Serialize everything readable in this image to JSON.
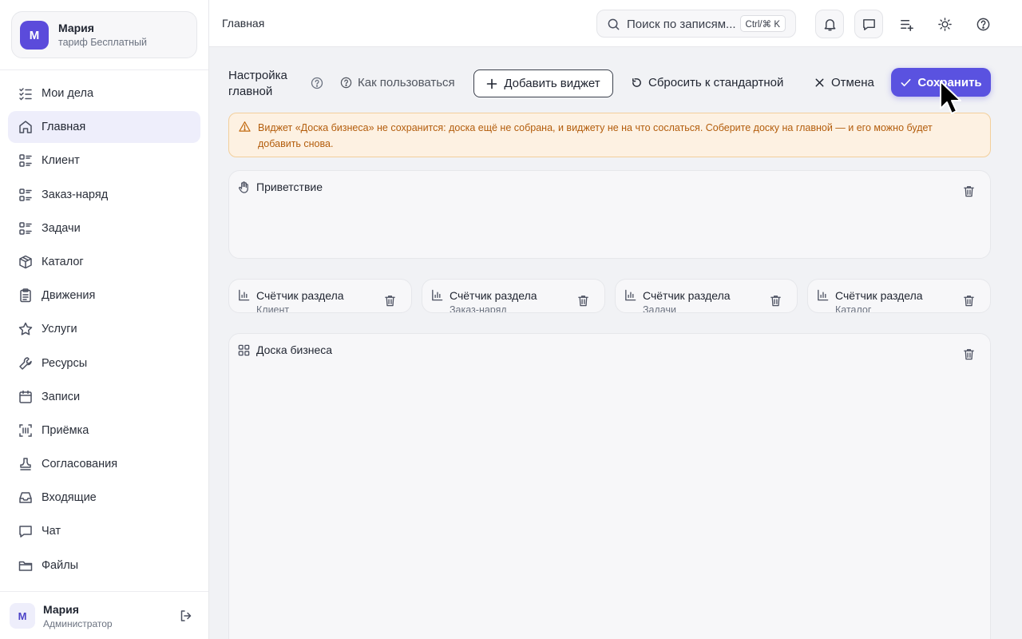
{
  "account": {
    "avatar": "М",
    "name": "Мария",
    "plan": "тариф Бесплатный"
  },
  "sidebar": {
    "items": [
      {
        "label": "Мои дела",
        "icon": "checklist-icon",
        "active": false
      },
      {
        "label": "Главная",
        "icon": "home-icon",
        "active": true
      },
      {
        "label": "Клиент",
        "icon": "list-icon",
        "active": false
      },
      {
        "label": "Заказ-наряд",
        "icon": "list-icon",
        "active": false
      },
      {
        "label": "Задачи",
        "icon": "list-icon",
        "active": false
      },
      {
        "label": "Каталог",
        "icon": "box-icon",
        "active": false
      },
      {
        "label": "Движения",
        "icon": "clipboard-icon",
        "active": false
      },
      {
        "label": "Услуги",
        "icon": "star-icon",
        "active": false
      },
      {
        "label": "Ресурсы",
        "icon": "wrench-icon",
        "active": false
      },
      {
        "label": "Записи",
        "icon": "calendar-icon",
        "active": false
      },
      {
        "label": "Приёмка",
        "icon": "scan-icon",
        "active": false
      },
      {
        "label": "Согласования",
        "icon": "stamp-icon",
        "active": false
      },
      {
        "label": "Входящие",
        "icon": "inbox-icon",
        "active": false
      },
      {
        "label": "Чат",
        "icon": "chat-icon",
        "active": false
      },
      {
        "label": "Файлы",
        "icon": "folder-icon",
        "active": false
      }
    ]
  },
  "user": {
    "avatar": "М",
    "name": "Мария",
    "role": "Администратор"
  },
  "topbar": {
    "breadcrumb": "Главная",
    "search_placeholder": "Поиск по записям...",
    "search_shortcut": "Ctrl/⌘ K"
  },
  "toolbar": {
    "title": "Настройка главной",
    "howto": "Как пользоваться",
    "add_widget": "Добавить виджет",
    "reset": "Сбросить к стандартной",
    "cancel": "Отмена",
    "save": "Сохранить"
  },
  "warning": {
    "text": "Виджет «Доска бизнеса» не сохранится: доска ещё не собрана, и виджету не на что сослаться. Соберите доску на главной — и его можно будет добавить снова."
  },
  "widgets": {
    "greeting": {
      "title": "Приветствие"
    },
    "counters": [
      {
        "title": "Счётчик раздела",
        "sub": "Клиент"
      },
      {
        "title": "Счётчик раздела",
        "sub": "Заказ-наряд"
      },
      {
        "title": "Счётчик раздела",
        "sub": "Задачи"
      },
      {
        "title": "Счётчик раздела",
        "sub": "Каталог"
      }
    ],
    "board": {
      "title": "Доска бизнеса"
    }
  },
  "colors": {
    "accent": "#5a52e0",
    "warning_bg": "#fdf1e2",
    "warning_text": "#b35d0c"
  }
}
